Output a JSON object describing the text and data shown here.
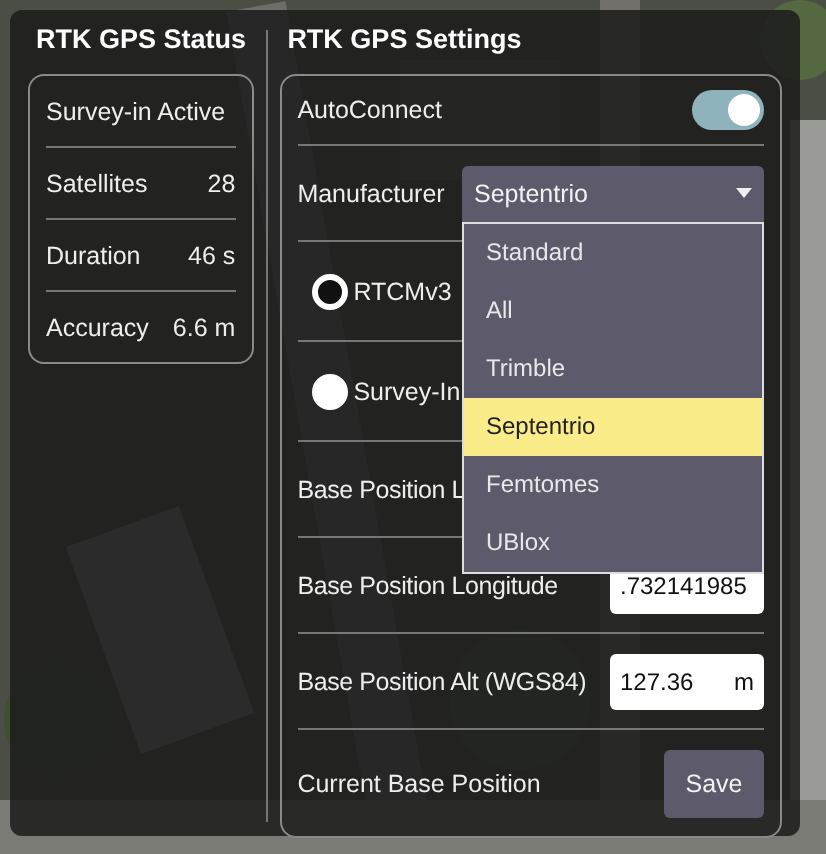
{
  "status": {
    "title": "RTK GPS Status",
    "rows": [
      {
        "label": "Survey-in Active"
      },
      {
        "label": "Satellites",
        "value": "28"
      },
      {
        "label": "Duration",
        "value": "46 s"
      },
      {
        "label": "Accuracy",
        "value": "6.6 m"
      }
    ]
  },
  "settings": {
    "title": "RTK GPS Settings",
    "autoconnect": {
      "label": "AutoConnect",
      "on": true
    },
    "manufacturer": {
      "label": "Manufacturer",
      "value": "Septentrio",
      "expanded": true,
      "options": [
        {
          "label": "Standard",
          "selected": false
        },
        {
          "label": "All",
          "selected": false
        },
        {
          "label": "Trimble",
          "selected": false
        },
        {
          "label": "Septentrio",
          "selected": true
        },
        {
          "label": "Femtomes",
          "selected": false
        },
        {
          "label": "UBlox",
          "selected": false
        }
      ]
    },
    "protocols": [
      {
        "label": "RTCMv3",
        "selected": true
      },
      {
        "label": "Survey-In",
        "selected": false
      }
    ],
    "fields": [
      {
        "label": "Base Position L"
      },
      {
        "label": "Base Position Longitude",
        "value": ".732141985"
      },
      {
        "label": "Base Position Alt (WGS84)",
        "value": "127.36",
        "unit": "m"
      }
    ],
    "current": {
      "label": "Current Base Position",
      "button": "Save"
    }
  }
}
